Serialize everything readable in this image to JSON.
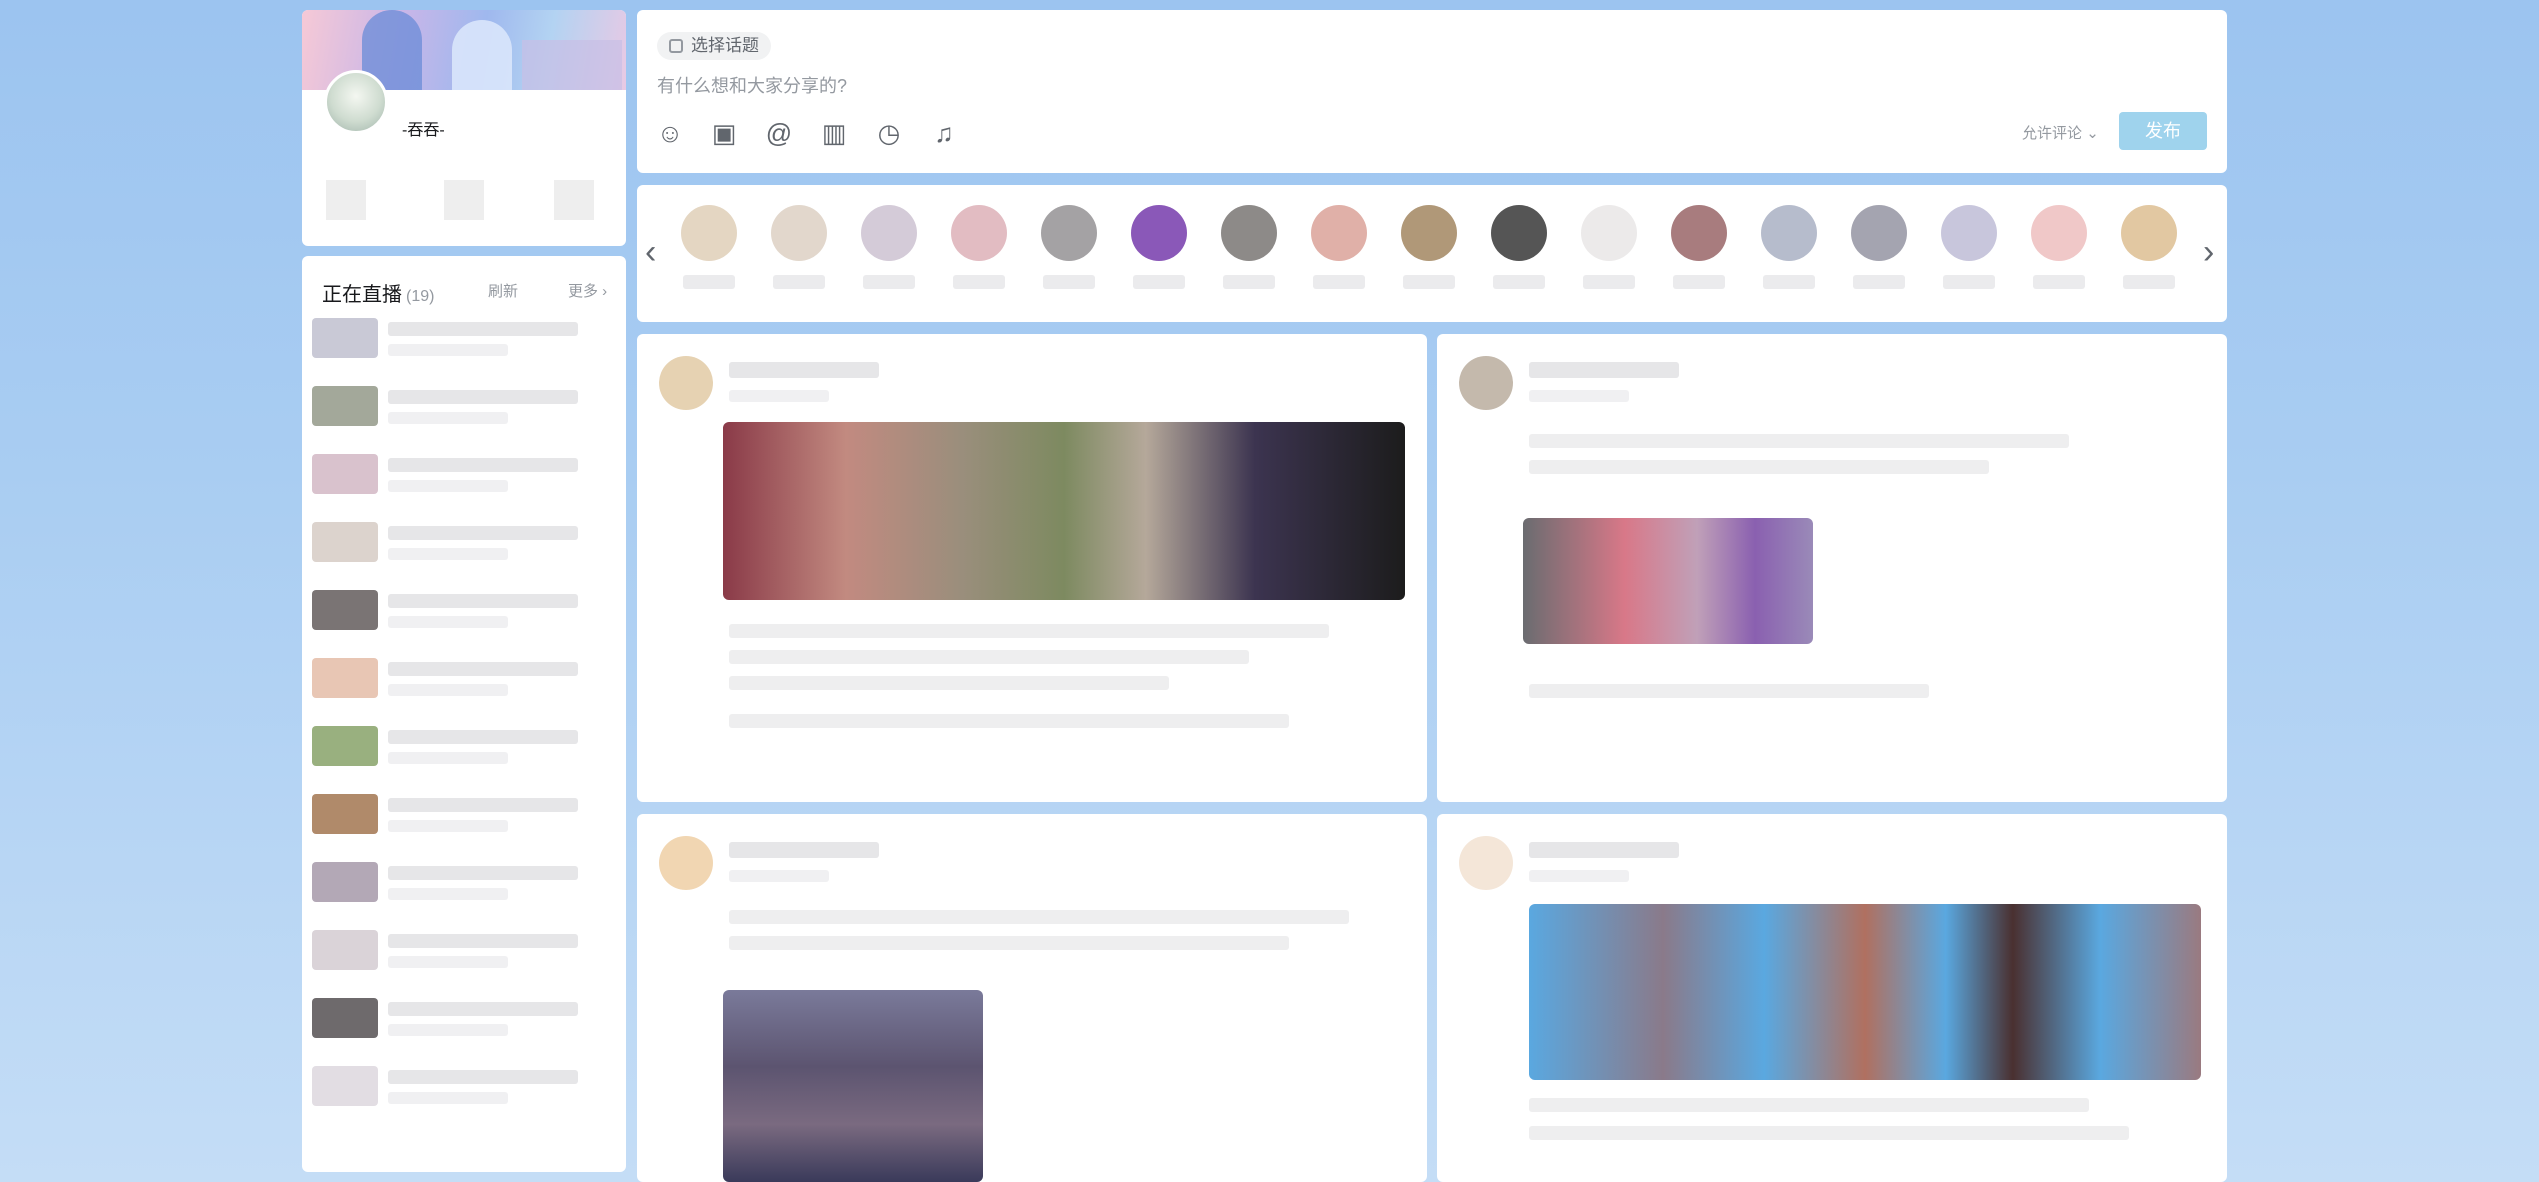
{
  "profile": {
    "username": "-吞吞-"
  },
  "live": {
    "title": "正在直播",
    "count": "(19)",
    "refresh_label": "刷新",
    "more_label": "更多"
  },
  "publish": {
    "topic_label": "选择话题",
    "placeholder": "有什么想和大家分享的?",
    "allow_comment_label": "允许评论",
    "publish_label": "发布",
    "tools": [
      "emoji-icon",
      "image-icon",
      "at-icon",
      "poll-icon",
      "schedule-icon",
      "reserve-icon"
    ]
  },
  "strip": {
    "left_arrow": "‹",
    "right_arrow": "›"
  },
  "tool_glyphs": {
    "emoji": "☺",
    "image": "▣",
    "at": "@",
    "poll": "▥",
    "schedule": "◷",
    "reserve": "♫"
  },
  "colors": {
    "accent": "#00aeec",
    "publish_button": "#9fd3ed",
    "text_primary": "#18191c",
    "text_secondary": "#9499a0"
  }
}
